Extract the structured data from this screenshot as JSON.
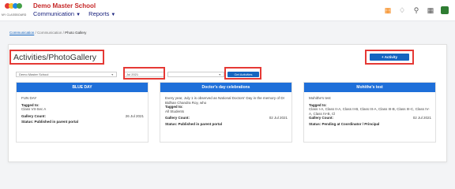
{
  "brand": {
    "logo_text": "MY CLASSBOARD",
    "school_name": "Demo Master School",
    "logo_colors": [
      "#e53935",
      "#fbc02d",
      "#1e88e5",
      "#43a047"
    ]
  },
  "nav": {
    "communication": "Communication",
    "reports": "Reports"
  },
  "header_icons": [
    "apps-grid-colorful-icon",
    "bell-icon",
    "search-icon",
    "grid-icon",
    "screen-icon"
  ],
  "breadcrumb": {
    "root": "Communication",
    "sep1": "/",
    "parent": "Communication",
    "sep2": "/",
    "current": "Photo Gallery"
  },
  "page": {
    "title": "Activities/PhotoGallery",
    "add_activity_label": "+ Activity"
  },
  "filters": {
    "school": "Demo Master School",
    "month": "Jul 2021",
    "third": "",
    "get_activities_label": "Get Activities"
  },
  "cards": [
    {
      "header": "BLUE DAY",
      "description": "FUN DAY",
      "tagged_label": "Tagged to:",
      "tagged": "Class VII-Sec A",
      "count_label": "Gallery Count:",
      "date": "26 Jul 2021",
      "status": "Status: Published in parent portal"
    },
    {
      "header": "Doctor's day celebrations",
      "description": "Every year, July 1 is observed as National Doctors' Day in the memory of Dr Bidhan Chandra Roy, who",
      "tagged_label": "Tagged to:",
      "tagged": "All Students",
      "count_label": "Gallery Count:",
      "date": "02 Jul 2021",
      "status": "Status: Published in parent portal"
    },
    {
      "header": "Mohithe's test",
      "description": "Mohithe's test",
      "tagged_label": "Tagged to:",
      "tagged": "Class I-A, Class II-A, Class II-B, Class III-A, Class III-B, Class III-C, Class IV-A, Class IV-B, Cl",
      "count_label": "Gallery Count:",
      "date": "02 Jul 2021",
      "status": "Status: Pending at Coordinator / Principal"
    }
  ]
}
